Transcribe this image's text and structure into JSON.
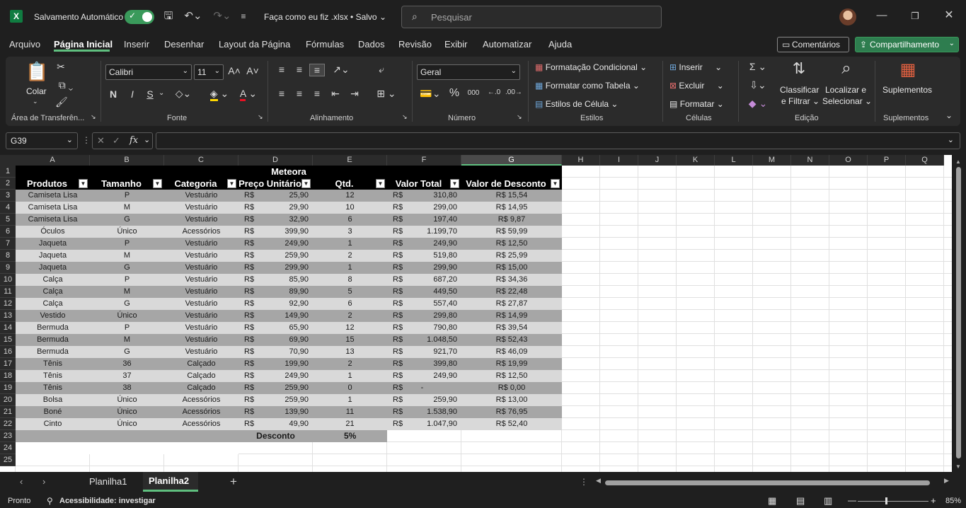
{
  "titlebar": {
    "app_icon": "excel-icon",
    "autosave_label": "Salvamento Automático",
    "autosave_on": true,
    "filename": "Faça como eu fiz .xlsx • Salvo",
    "search_placeholder": "Pesquisar"
  },
  "menu": {
    "items": [
      "Arquivo",
      "Página Inicial",
      "Inserir",
      "Desenhar",
      "Layout da Página",
      "Fórmulas",
      "Dados",
      "Revisão",
      "Exibir",
      "Automatizar",
      "Ajuda"
    ],
    "active": "Página Inicial",
    "comments_label": "Comentários",
    "share_label": "Compartilhamento"
  },
  "ribbon": {
    "clipboard": {
      "paste_label": "Colar",
      "group": "Área de Transferên..."
    },
    "font": {
      "font_name": "Calibri",
      "font_size": "11",
      "bold": "N",
      "italic": "I",
      "underline": "S",
      "group": "Fonte"
    },
    "alignment": {
      "group": "Alinhamento"
    },
    "number": {
      "format": "Geral",
      "group": "Número"
    },
    "styles": {
      "conditional": "Formatação Condicional",
      "as_table": "Formatar como Tabela",
      "cell_styles": "Estilos de Célula",
      "group": "Estilos"
    },
    "cells": {
      "insert": "Inserir",
      "delete": "Excluir",
      "format": "Formatar",
      "group": "Células"
    },
    "editing": {
      "sort_filter_1": "Classificar",
      "sort_filter_2": "e Filtrar",
      "find_1": "Localizar e",
      "find_2": "Selecionar",
      "group": "Edição"
    },
    "addins": {
      "label": "Suplementos",
      "group": "Suplementos"
    }
  },
  "formula_bar": {
    "name_box": "G39",
    "fx": "fx",
    "formula": ""
  },
  "grid": {
    "columns": [
      "A",
      "B",
      "C",
      "D",
      "E",
      "F",
      "G",
      "H",
      "I",
      "J",
      "K",
      "L",
      "M",
      "N",
      "O",
      "P",
      "Q"
    ],
    "selected_column": "G",
    "rows": [
      "1",
      "2",
      "3",
      "4",
      "5",
      "6",
      "7",
      "8",
      "9",
      "10",
      "11",
      "12",
      "13",
      "14",
      "15",
      "16",
      "17",
      "18",
      "19",
      "20",
      "21",
      "22",
      "23",
      "24",
      "25"
    ],
    "title": "Meteora",
    "headers": [
      "Produtos",
      "Tamanho",
      "Categoria",
      "Preço Unitário",
      "Qtd.",
      "Valor Total",
      "Valor de Desconto"
    ],
    "currency": "R$",
    "data": [
      [
        "Camiseta Lisa",
        "P",
        "Vestuário",
        "25,90",
        "12",
        "310,80",
        "R$ 15,54"
      ],
      [
        "Camiseta Lisa",
        "M",
        "Vestuário",
        "29,90",
        "10",
        "299,00",
        "R$ 14,95"
      ],
      [
        "Camiseta Lisa",
        "G",
        "Vestuário",
        "32,90",
        "6",
        "197,40",
        "R$ 9,87"
      ],
      [
        "Óculos",
        "Único",
        "Acessórios",
        "399,90",
        "3",
        "1.199,70",
        "R$ 59,99"
      ],
      [
        "Jaqueta",
        "P",
        "Vestuário",
        "249,90",
        "1",
        "249,90",
        "R$ 12,50"
      ],
      [
        "Jaqueta",
        "M",
        "Vestuário",
        "259,90",
        "2",
        "519,80",
        "R$ 25,99"
      ],
      [
        "Jaqueta",
        "G",
        "Vestuário",
        "299,90",
        "1",
        "299,90",
        "R$ 15,00"
      ],
      [
        "Calça",
        "P",
        "Vestuário",
        "85,90",
        "8",
        "687,20",
        "R$ 34,36"
      ],
      [
        "Calça",
        "M",
        "Vestuário",
        "89,90",
        "5",
        "449,50",
        "R$ 22,48"
      ],
      [
        "Calça",
        "G",
        "Vestuário",
        "92,90",
        "6",
        "557,40",
        "R$ 27,87"
      ],
      [
        "Vestido",
        "Único",
        "Vestuário",
        "149,90",
        "2",
        "299,80",
        "R$ 14,99"
      ],
      [
        "Bermuda",
        "P",
        "Vestuário",
        "65,90",
        "12",
        "790,80",
        "R$ 39,54"
      ],
      [
        "Bermuda",
        "M",
        "Vestuário",
        "69,90",
        "15",
        "1.048,50",
        "R$ 52,43"
      ],
      [
        "Bermuda",
        "G",
        "Vestuário",
        "70,90",
        "13",
        "921,70",
        "R$ 46,09"
      ],
      [
        "Tênis",
        "36",
        "Calçado",
        "199,90",
        "2",
        "399,80",
        "R$ 19,99"
      ],
      [
        "Tênis",
        "37",
        "Calçado",
        "249,90",
        "1",
        "249,90",
        "R$ 12,50"
      ],
      [
        "Tênis",
        "38",
        "Calçado",
        "259,90",
        "0",
        "-",
        "R$ 0,00"
      ],
      [
        "Bolsa",
        "Único",
        "Acessórios",
        "259,90",
        "1",
        "259,90",
        "R$ 13,00"
      ],
      [
        "Boné",
        "Único",
        "Acessórios",
        "139,90",
        "11",
        "1.538,90",
        "R$ 76,95"
      ],
      [
        "Cinto",
        "Único",
        "Acessórios",
        "49,90",
        "21",
        "1.047,90",
        "R$ 52,40"
      ]
    ],
    "discount_label": "Desconto",
    "discount_value": "5%"
  },
  "sheets": {
    "tabs": [
      "Planilha1",
      "Planilha2"
    ],
    "active": "Planilha2"
  },
  "status": {
    "ready": "Pronto",
    "accessibility": "Acessibilidade: investigar",
    "zoom": "85%"
  },
  "colors": {
    "header_bg": "#000000",
    "row_dark": "#a6a6a6",
    "row_light": "#d9d9d9",
    "accent": "#5fbf7f",
    "share": "#2e7d4f"
  }
}
